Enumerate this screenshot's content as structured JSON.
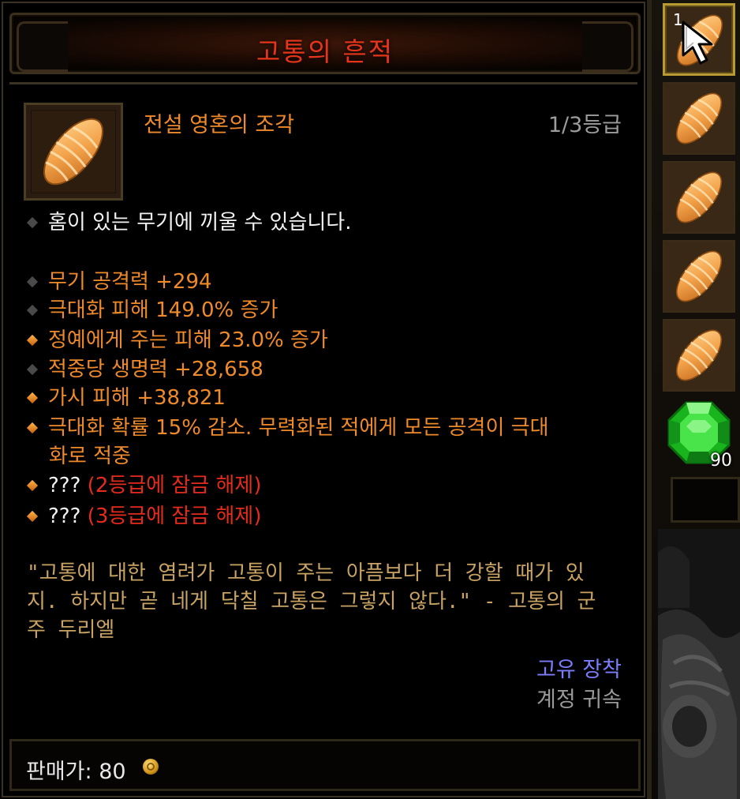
{
  "tooltip": {
    "title": "고통의 흔적",
    "item_name": "전설 영혼의 조각",
    "rank": "1/3등급",
    "socket_text": "홈이 있는 무기에 끼울 수 있습니다.",
    "stats": [
      {
        "text": "무기 공격력 +294",
        "bullet": "grey"
      },
      {
        "text": "극대화 피해 149.0% 증가",
        "bullet": "grey"
      },
      {
        "text": "정예에게 주는 피해 23.0% 증가",
        "bullet": "gold"
      },
      {
        "text": "적중당 생명력 +28,658",
        "bullet": "grey"
      },
      {
        "text": "가시 피해 +38,821",
        "bullet": "gold"
      },
      {
        "text": "극대화 확률 15% 감소. 무력화된 적에게 모든 공격이 극대",
        "continuation": "화로 적중",
        "bullet": "gold"
      }
    ],
    "locked": [
      {
        "prefix": "???",
        "text": "(2등급에 잠금 해제)"
      },
      {
        "prefix": "???",
        "text": "(3등급에 잠금 해제)"
      }
    ],
    "flavor_lines": [
      "\"고통에 대한 염려가 고통이 주는 아픔보다 더 강할 때가 있",
      "지. 하지만 곧 네게 닥칠 고통은 그렇지 않다.\" - 고통의 군",
      "주 두리엘"
    ],
    "bind_unique": "고유 장착",
    "bind_account": "계정 귀속",
    "sell_label": "판매가: 80"
  },
  "inventory": {
    "selected_count": "1",
    "gem_count": "90"
  },
  "colors": {
    "title": "#e7351c",
    "legendary": "#ef8a2b",
    "locked": "#e52b1c",
    "unique_bind": "#7b7dfb",
    "flavor": "#c9a363"
  }
}
